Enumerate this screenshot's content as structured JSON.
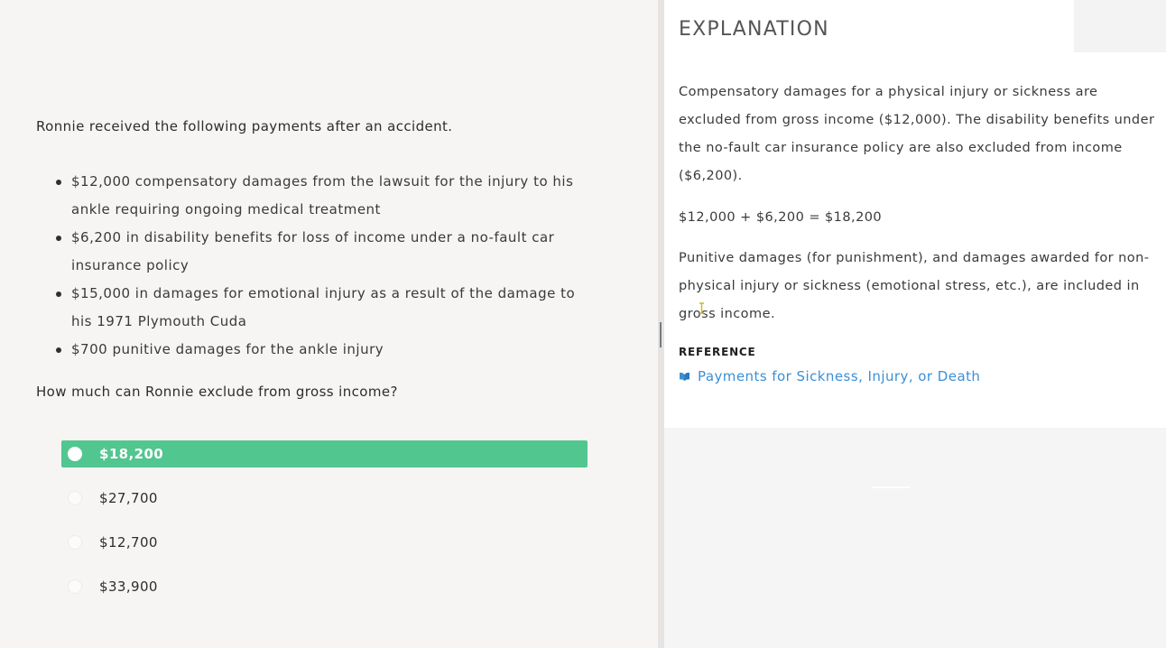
{
  "question": {
    "intro": "Ronnie received the following payments after an accident.",
    "items": [
      {
        "line1": "$12,000 compensatory damages from the lawsuit for the injury to his",
        "line2": "ankle requiring ongoing medical treatment"
      },
      {
        "line1": "$6,200 in disability benefits for loss of income under a no-fault car",
        "line2": "insurance policy"
      },
      {
        "line1": "$15,000 in damages for emotional injury as a result of the damage to",
        "line2": "his 1971 Plymouth Cuda"
      },
      {
        "line1": "$700 punitive damages for the ankle injury",
        "line2": ""
      }
    ],
    "ask": "How much can Ronnie exclude from gross income?"
  },
  "answers": [
    {
      "label": "$18,200",
      "selected": true
    },
    {
      "label": "$27,700",
      "selected": false
    },
    {
      "label": "$12,700",
      "selected": false
    },
    {
      "label": "$33,900",
      "selected": false
    }
  ],
  "explanation": {
    "title": "EXPLANATION",
    "p1": {
      "l1": "Compensatory damages for a physical injury or sickness are",
      "l2": "excluded from gross income ($12,000). The disability benefits under",
      "l3": "the no-fault car insurance policy are also excluded from income",
      "l4": "($6,200)."
    },
    "equation": "$12,000 + $6,200 = $18,200",
    "p2": {
      "l1": "Punitive damages (for punishment), and damages awarded for non-",
      "l2": "physical injury or sickness (emotional stress, etc.), are included in",
      "l3": "gross income."
    },
    "reference_heading": "REFERENCE",
    "reference_link": "Payments for Sickness, Injury, or Death",
    "reference_icon": "book-icon"
  },
  "colors": {
    "selected_answer": "#52c68f",
    "link": "#3b8fd6"
  }
}
